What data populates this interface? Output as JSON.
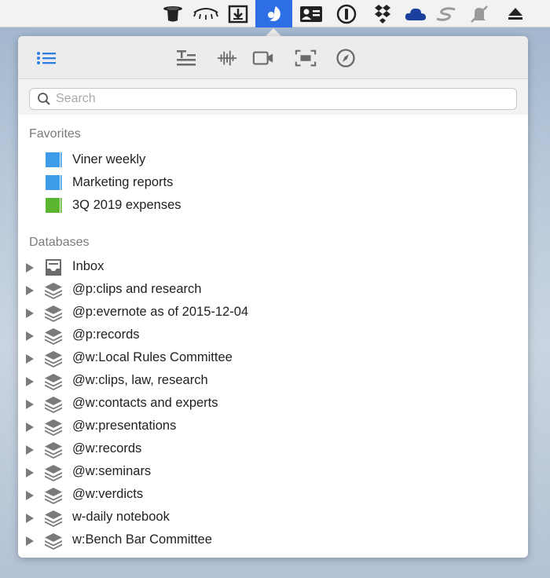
{
  "menubar": {
    "icons": [
      {
        "name": "top-hat-icon"
      },
      {
        "name": "eye-icon"
      },
      {
        "name": "download-box-icon"
      },
      {
        "name": "devonthink-icon",
        "active": true
      },
      {
        "name": "contact-card-icon"
      },
      {
        "name": "onepassword-icon"
      },
      {
        "name": "dropbox-icon"
      },
      {
        "name": "cloud-icon"
      },
      {
        "name": "s-logo-icon"
      },
      {
        "name": "muted-bell-icon"
      },
      {
        "name": "eject-icon"
      }
    ],
    "accent": "#2e6fe6"
  },
  "toolbar": {
    "buttons": [
      "list-icon",
      "text-format-icon",
      "audio-waveform-icon",
      "video-camera-icon",
      "screenshot-frame-icon",
      "compass-icon"
    ]
  },
  "search": {
    "placeholder": "Search",
    "value": ""
  },
  "favorites": {
    "heading": "Favorites",
    "items": [
      {
        "label": "Viner weekly",
        "color": "#3d9be9"
      },
      {
        "label": "Marketing reports",
        "color": "#3d9be9"
      },
      {
        "label": "3Q 2019 expenses",
        "color": "#5cb531"
      }
    ]
  },
  "databases": {
    "heading": "Databases",
    "items": [
      {
        "label": "Inbox",
        "icon": "inbox-icon"
      },
      {
        "label": "@p:clips and research",
        "icon": "database-stack-icon"
      },
      {
        "label": "@p:evernote as of 2015-12-04",
        "icon": "database-stack-icon"
      },
      {
        "label": "@p:records",
        "icon": "database-stack-icon"
      },
      {
        "label": "@w:Local Rules Committee",
        "icon": "database-stack-icon"
      },
      {
        "label": "@w:clips, law, research",
        "icon": "database-stack-icon"
      },
      {
        "label": "@w:contacts and experts",
        "icon": "database-stack-icon"
      },
      {
        "label": "@w:presentations",
        "icon": "database-stack-icon"
      },
      {
        "label": "@w:records",
        "icon": "database-stack-icon"
      },
      {
        "label": "@w:seminars",
        "icon": "database-stack-icon"
      },
      {
        "label": "@w:verdicts",
        "icon": "database-stack-icon"
      },
      {
        "label": "w-daily notebook",
        "icon": "database-stack-icon"
      },
      {
        "label": "w:Bench Bar Committee",
        "icon": "database-stack-icon"
      }
    ]
  }
}
